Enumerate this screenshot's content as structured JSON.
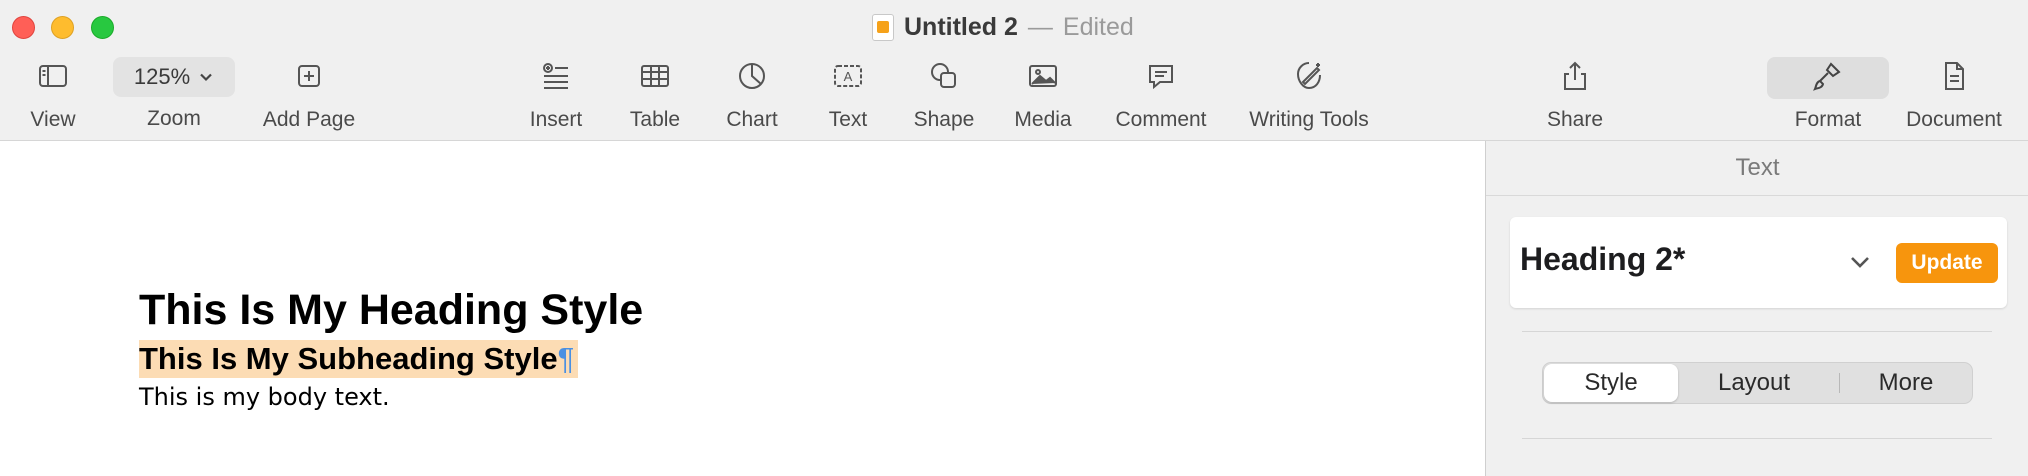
{
  "window": {
    "title": "Untitled 2",
    "separator": "—",
    "status": "Edited"
  },
  "toolbar": {
    "view": "View",
    "zoom_value": "125%",
    "zoom": "Zoom",
    "add_page": "Add Page",
    "insert": "Insert",
    "table": "Table",
    "chart": "Chart",
    "text": "Text",
    "shape": "Shape",
    "media": "Media",
    "comment": "Comment",
    "writing_tools": "Writing Tools",
    "share": "Share",
    "format": "Format",
    "document": "Document"
  },
  "document": {
    "heading": "This Is My Heading Style",
    "subheading": "This Is My Subheading Style",
    "pilcrow": "¶",
    "body": "This is my body text."
  },
  "sidebar": {
    "tab": "Text",
    "paragraph_style": "Heading 2*",
    "update_label": "Update",
    "segments": [
      "Style",
      "Layout",
      "More"
    ],
    "active_segment": "Style"
  },
  "colors": {
    "accent": "#f7950d",
    "selection": "#fcdcb4",
    "pilcrow": "#4a90e2"
  }
}
